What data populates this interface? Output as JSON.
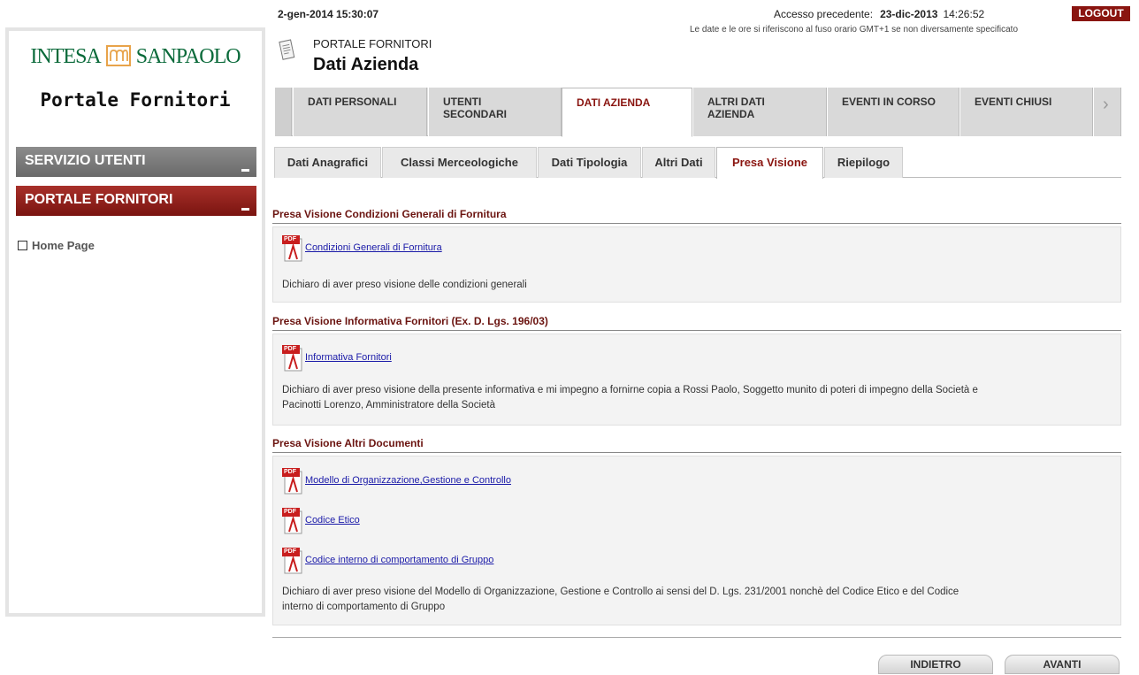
{
  "header": {
    "datetime": "2-gen-2014 15:30:07",
    "last_access_label": "Accesso precedente:",
    "last_access_date": "23-dic-2013",
    "last_access_time": "14:26:52",
    "logout_label": "LOGOUT",
    "timezone_note": "Le date e le ore si riferiscono al fuso orario GMT+1 se non diversamente specificato",
    "breadcrumb": "PORTALE FORNITORI",
    "page_title": "Dati Azienda"
  },
  "sidebar": {
    "brand_left": "INTESA",
    "brand_right": "SANPAOLO",
    "brand_sub": "Portale Fornitori",
    "menu_service": "SERVIZIO UTENTI",
    "menu_portal": "PORTALE FORNITORI",
    "home_link": "Home Page"
  },
  "main_tabs": [
    {
      "line1": "DATI PERSONALI",
      "line2": ""
    },
    {
      "line1": "UTENTI",
      "line2": "SECONDARI"
    },
    {
      "line1": "DATI AZIENDA",
      "line2": ""
    },
    {
      "line1": "ALTRI DATI",
      "line2": "AZIENDA"
    },
    {
      "line1": "EVENTI IN CORSO",
      "line2": ""
    },
    {
      "line1": "EVENTI CHIUSI",
      "line2": ""
    }
  ],
  "main_tabs_arrow": "›",
  "sub_tabs": [
    "Dati Anagrafici",
    "Classi Merceologiche",
    "Dati Tipologia",
    "Altri Dati",
    "Presa Visione",
    "Riepilogo"
  ],
  "sections": [
    {
      "title": "Presa Visione Condizioni Generali di Fornitura",
      "docs": [
        "Condizioni Generali di Fornitura"
      ],
      "declaration": "Dichiaro di aver preso visione delle condizioni generali"
    },
    {
      "title": "Presa Visione Informativa Fornitori (Ex. D. Lgs. 196/03)",
      "docs": [
        "Informativa Fornitori"
      ],
      "declaration_line1": "Dichiaro di aver preso visione della presente informativa e mi impegno a fornirne copia a Rossi Paolo, Soggetto munito di poteri di impegno della Società e",
      "declaration_line2": "Pacinotti Lorenzo, Amministratore della Società"
    },
    {
      "title": "Presa Visione Altri Documenti",
      "docs": [
        "Modello di Organizzazione,Gestione e Controllo",
        "Codice Etico",
        "Codice interno di comportamento di Gruppo"
      ],
      "declaration_line1": "Dichiaro di aver preso visione del Modello di Organizzazione, Gestione e Controllo ai sensi del D. Lgs. 231/2001 nonchè del Codice Etico e del Codice",
      "declaration_line2": "interno di comportamento di Gruppo"
    }
  ],
  "pdf_icon_label": "PDF",
  "buttons": {
    "back": "INDIETRO",
    "next": "AVANTI"
  },
  "colors": {
    "accent": "#8a1510",
    "brand_green": "#0a6a3a",
    "link": "#1a1aa8"
  }
}
